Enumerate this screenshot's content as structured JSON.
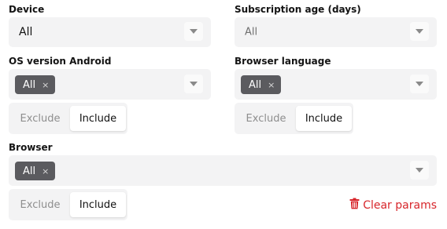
{
  "filters": {
    "device": {
      "label": "Device",
      "value": "All"
    },
    "subscription_age": {
      "label": "Subscription age (days)",
      "placeholder": "All"
    },
    "os_version": {
      "label": "OS version Android",
      "chip": "All",
      "chip_remove": "×"
    },
    "browser_language": {
      "label": "Browser language",
      "chip": "All",
      "chip_remove": "×"
    },
    "browser": {
      "label": "Browser",
      "chip": "All",
      "chip_remove": "×"
    }
  },
  "toggles": {
    "exclude_label": "Exclude",
    "include_label": "Include",
    "selected": "Include"
  },
  "actions": {
    "clear_label": "Clear params",
    "clear_icon": "trash-icon",
    "clear_color": "#d7262b"
  }
}
